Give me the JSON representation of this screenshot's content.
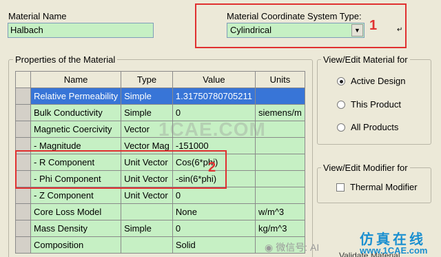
{
  "material_name": {
    "label": "Material Name",
    "value": "Halbach"
  },
  "coord_system": {
    "label": "Material Coordinate System Type:",
    "value": "Cylindrical"
  },
  "annotations": {
    "one": "1",
    "two": "2"
  },
  "properties": {
    "title": "Properties of the Material",
    "columns": [
      "Name",
      "Type",
      "Value",
      "Units"
    ],
    "rows": [
      {
        "name": "Relative Permeability",
        "type": "Simple",
        "value": "1.31750780705211",
        "units": ""
      },
      {
        "name": "Bulk Conductivity",
        "type": "Simple",
        "value": "0",
        "units": "siemens/m"
      },
      {
        "name": "Magnetic Coercivity",
        "type": "Vector",
        "value": "",
        "units": ""
      },
      {
        "name": "- Magnitude",
        "type": "Vector Mag",
        "value": "-151000",
        "units": ""
      },
      {
        "name": "- R Component",
        "type": "Unit Vector",
        "value": "Cos(6*phi)",
        "units": ""
      },
      {
        "name": "- Phi Component",
        "type": "Unit Vector",
        "value": "-sin(6*phi)",
        "units": ""
      },
      {
        "name": "- Z Component",
        "type": "Unit Vector",
        "value": "0",
        "units": ""
      },
      {
        "name": "Core Loss Model",
        "type": "",
        "value": "None",
        "units": "w/m^3"
      },
      {
        "name": "Mass Density",
        "type": "Simple",
        "value": "0",
        "units": "kg/m^3"
      },
      {
        "name": "Composition",
        "type": "",
        "value": "Solid",
        "units": ""
      }
    ]
  },
  "view_edit_material": {
    "title": "View/Edit Material for",
    "options": [
      {
        "label": "Active Design",
        "selected": true
      },
      {
        "label": "This Product",
        "selected": false
      },
      {
        "label": "All Products",
        "selected": false
      }
    ]
  },
  "view_edit_modifier": {
    "title": "View/Edit Modifier for",
    "thermal_label": "Thermal Modifier"
  },
  "bottom_partial": "Validate Material",
  "watermarks": {
    "center": "1CAE.COM",
    "wechat": "微信号: AI",
    "site_cn": "仿真在线",
    "site": "www.1CAE.com"
  }
}
